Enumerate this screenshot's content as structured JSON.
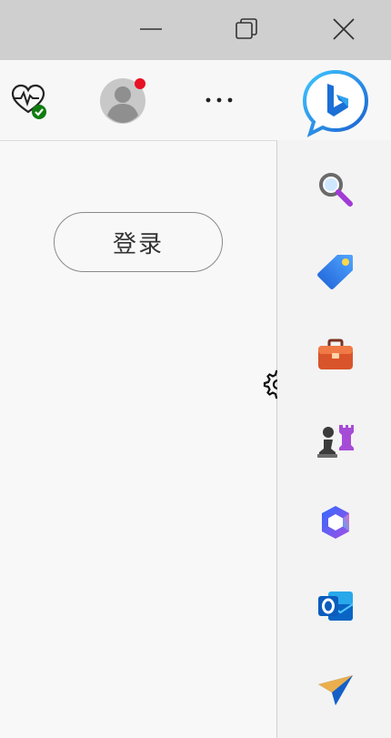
{
  "window": {
    "controls": [
      "minimize",
      "restore",
      "close"
    ]
  },
  "toolbar": {
    "health_icon": "browser-essentials-heart-check-icon",
    "profile_icon": "profile-avatar-icon",
    "profile_badge_color": "#e81123",
    "more_icon": "more-ellipsis-icon",
    "copilot_icon": "bing-copilot-icon"
  },
  "panel": {
    "login_label": "登录",
    "settings_icon": "gear-icon"
  },
  "sidebar": {
    "items": [
      {
        "name": "search",
        "icon": "search-icon"
      },
      {
        "name": "shopping",
        "icon": "tag-icon"
      },
      {
        "name": "tools",
        "icon": "toolbox-icon"
      },
      {
        "name": "games",
        "icon": "chess-icon"
      },
      {
        "name": "microsoft-365",
        "icon": "microsoft-365-icon"
      },
      {
        "name": "outlook",
        "icon": "outlook-icon"
      },
      {
        "name": "drop",
        "icon": "paper-plane-icon"
      }
    ]
  },
  "colors": {
    "accent_blue": "#1b6fd6",
    "title_bar": "#cfcfcf"
  }
}
